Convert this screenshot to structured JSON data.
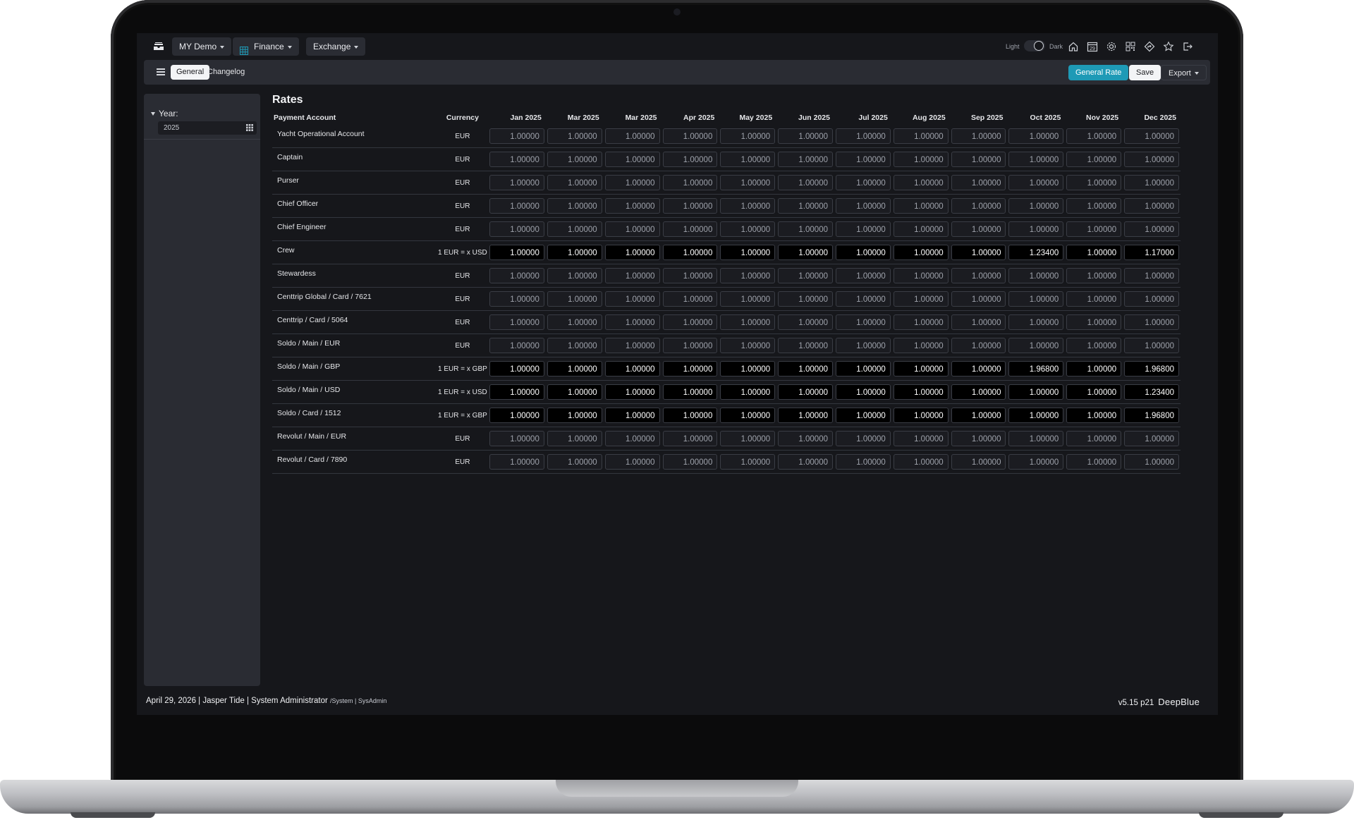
{
  "topbar": {
    "demo_label": "MY Demo",
    "module_label": "Finance",
    "section_label": "Exchange",
    "theme_light": "Light",
    "theme_dark": "Dark",
    "calendar_day": "29"
  },
  "subbar": {
    "tabs": [
      {
        "label": "General",
        "active": true
      },
      {
        "label": "Changelog",
        "active": false
      }
    ],
    "general_rate_label": "General Rate",
    "save_label": "Save",
    "export_label": "Export"
  },
  "sidebar": {
    "year_label": "Year:",
    "year_value": "2025"
  },
  "main": {
    "title": "Rates",
    "columns": [
      "Payment Account",
      "Currency",
      "Jan 2025",
      "Mar 2025",
      "Mar 2025",
      "Apr 2025",
      "May 2025",
      "Jun 2025",
      "Jul 2025",
      "Aug 2025",
      "Sep 2025",
      "Oct 2025",
      "Nov 2025",
      "Dec 2025"
    ],
    "rows": [
      {
        "account": "Yacht Operational Account",
        "currency": "EUR",
        "editable": false,
        "values": [
          "1.00000",
          "1.00000",
          "1.00000",
          "1.00000",
          "1.00000",
          "1.00000",
          "1.00000",
          "1.00000",
          "1.00000",
          "1.00000",
          "1.00000",
          "1.00000"
        ]
      },
      {
        "account": "Captain",
        "currency": "EUR",
        "editable": false,
        "values": [
          "1.00000",
          "1.00000",
          "1.00000",
          "1.00000",
          "1.00000",
          "1.00000",
          "1.00000",
          "1.00000",
          "1.00000",
          "1.00000",
          "1.00000",
          "1.00000"
        ]
      },
      {
        "account": "Purser",
        "currency": "EUR",
        "editable": false,
        "values": [
          "1.00000",
          "1.00000",
          "1.00000",
          "1.00000",
          "1.00000",
          "1.00000",
          "1.00000",
          "1.00000",
          "1.00000",
          "1.00000",
          "1.00000",
          "1.00000"
        ]
      },
      {
        "account": "Chief Officer",
        "currency": "EUR",
        "editable": false,
        "values": [
          "1.00000",
          "1.00000",
          "1.00000",
          "1.00000",
          "1.00000",
          "1.00000",
          "1.00000",
          "1.00000",
          "1.00000",
          "1.00000",
          "1.00000",
          "1.00000"
        ]
      },
      {
        "account": "Chief Engineer",
        "currency": "EUR",
        "editable": false,
        "values": [
          "1.00000",
          "1.00000",
          "1.00000",
          "1.00000",
          "1.00000",
          "1.00000",
          "1.00000",
          "1.00000",
          "1.00000",
          "1.00000",
          "1.00000",
          "1.00000"
        ]
      },
      {
        "account": "Crew",
        "currency": "1 EUR = x USD",
        "editable": true,
        "values": [
          "1.00000",
          "1.00000",
          "1.00000",
          "1.00000",
          "1.00000",
          "1.00000",
          "1.00000",
          "1.00000",
          "1.00000",
          "1.23400",
          "1.00000",
          "1.17000"
        ]
      },
      {
        "account": "Stewardess",
        "currency": "EUR",
        "editable": false,
        "values": [
          "1.00000",
          "1.00000",
          "1.00000",
          "1.00000",
          "1.00000",
          "1.00000",
          "1.00000",
          "1.00000",
          "1.00000",
          "1.00000",
          "1.00000",
          "1.00000"
        ]
      },
      {
        "account": "Centtrip Global / Card / 7621",
        "currency": "EUR",
        "editable": false,
        "values": [
          "1.00000",
          "1.00000",
          "1.00000",
          "1.00000",
          "1.00000",
          "1.00000",
          "1.00000",
          "1.00000",
          "1.00000",
          "1.00000",
          "1.00000",
          "1.00000"
        ]
      },
      {
        "account": "Centtrip / Card / 5064",
        "currency": "EUR",
        "editable": false,
        "values": [
          "1.00000",
          "1.00000",
          "1.00000",
          "1.00000",
          "1.00000",
          "1.00000",
          "1.00000",
          "1.00000",
          "1.00000",
          "1.00000",
          "1.00000",
          "1.00000"
        ]
      },
      {
        "account": "Soldo / Main / EUR",
        "currency": "EUR",
        "editable": false,
        "values": [
          "1.00000",
          "1.00000",
          "1.00000",
          "1.00000",
          "1.00000",
          "1.00000",
          "1.00000",
          "1.00000",
          "1.00000",
          "1.00000",
          "1.00000",
          "1.00000"
        ]
      },
      {
        "account": "Soldo / Main / GBP",
        "currency": "1 EUR = x GBP",
        "editable": true,
        "values": [
          "1.00000",
          "1.00000",
          "1.00000",
          "1.00000",
          "1.00000",
          "1.00000",
          "1.00000",
          "1.00000",
          "1.00000",
          "1.96800",
          "1.00000",
          "1.96800"
        ]
      },
      {
        "account": "Soldo / Main / USD",
        "currency": "1 EUR = x USD",
        "editable": true,
        "values": [
          "1.00000",
          "1.00000",
          "1.00000",
          "1.00000",
          "1.00000",
          "1.00000",
          "1.00000",
          "1.00000",
          "1.00000",
          "1.00000",
          "1.00000",
          "1.23400"
        ]
      },
      {
        "account": "Soldo / Card / 1512",
        "currency": "1 EUR = x GBP",
        "editable": true,
        "values": [
          "1.00000",
          "1.00000",
          "1.00000",
          "1.00000",
          "1.00000",
          "1.00000",
          "1.00000",
          "1.00000",
          "1.00000",
          "1.00000",
          "1.00000",
          "1.96800"
        ]
      },
      {
        "account": "Revolut / Main / EUR",
        "currency": "EUR",
        "editable": false,
        "values": [
          "1.00000",
          "1.00000",
          "1.00000",
          "1.00000",
          "1.00000",
          "1.00000",
          "1.00000",
          "1.00000",
          "1.00000",
          "1.00000",
          "1.00000",
          "1.00000"
        ]
      },
      {
        "account": "Revolut / Card / 7890",
        "currency": "EUR",
        "editable": false,
        "values": [
          "1.00000",
          "1.00000",
          "1.00000",
          "1.00000",
          "1.00000",
          "1.00000",
          "1.00000",
          "1.00000",
          "1.00000",
          "1.00000",
          "1.00000",
          "1.00000"
        ]
      }
    ]
  },
  "footer": {
    "status": "April 29, 2026 | Jasper Tide | System Administrator",
    "role": "/System | SysAdmin",
    "version": "v5.15 p21",
    "brand": "DeepBlue"
  },
  "colors": {
    "accent": "#1e9ab6",
    "background": "#16171b",
    "panel": "#2a2c33"
  },
  "icons": [
    "inbox-icon",
    "grid-icon",
    "home-icon",
    "calendar-icon",
    "gear-icon",
    "qr-code-icon",
    "directions-icon",
    "star-icon",
    "logout-icon",
    "menu-icon"
  ]
}
